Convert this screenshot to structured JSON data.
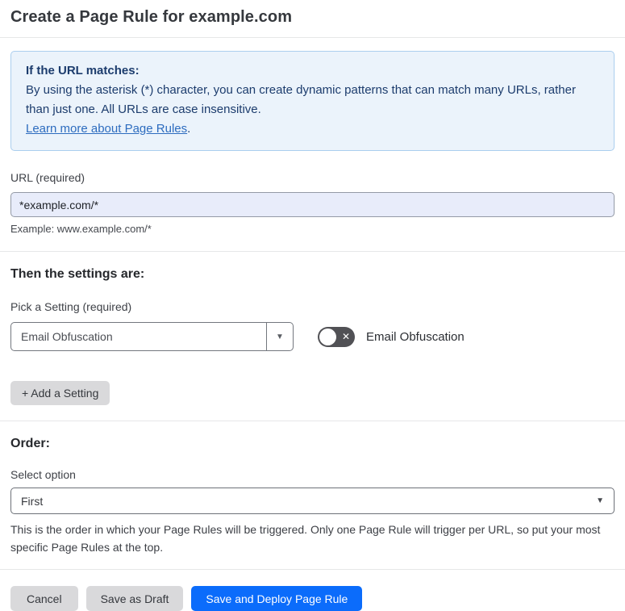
{
  "page": {
    "title": "Create a Page Rule for example.com"
  },
  "notice": {
    "heading": "If the URL matches:",
    "body": "By using the asterisk (*) character, you can create dynamic patterns that can match many URLs, rather than just one. All URLs are case insensitive.",
    "link_label": "Learn more about Page Rules",
    "link_suffix": "."
  },
  "url_field": {
    "label": "URL (required)",
    "value": "*example.com/*",
    "example": "Example: www.example.com/*"
  },
  "settings": {
    "heading": "Then the settings are:",
    "pick_label": "Pick a Setting (required)",
    "selected_value": "Email Obfuscation",
    "toggle_label": "Email Obfuscation",
    "toggle_state": "off",
    "add_button_label": "+ Add a Setting"
  },
  "order": {
    "heading": "Order:",
    "label": "Select option",
    "selected_value": "First",
    "help": "This is the order in which your Page Rules will be triggered. Only one Page Rule will trigger per URL, so put your most specific Page Rules at the top."
  },
  "footer": {
    "cancel_label": "Cancel",
    "save_draft_label": "Save as Draft",
    "save_deploy_label": "Save and Deploy Page Rule"
  },
  "icons": {
    "chevron_down": "▼",
    "close_x": "✕"
  },
  "colors": {
    "accent_blue": "#0b6cfb",
    "notice_bg": "#ebf3fb",
    "notice_border": "#abceee",
    "notice_text": "#1c3c6d",
    "link_blue": "#2d6cbf",
    "input_bg": "#e8ecfa",
    "toggle_track": "#515155",
    "button_gray": "#d9d9db"
  }
}
